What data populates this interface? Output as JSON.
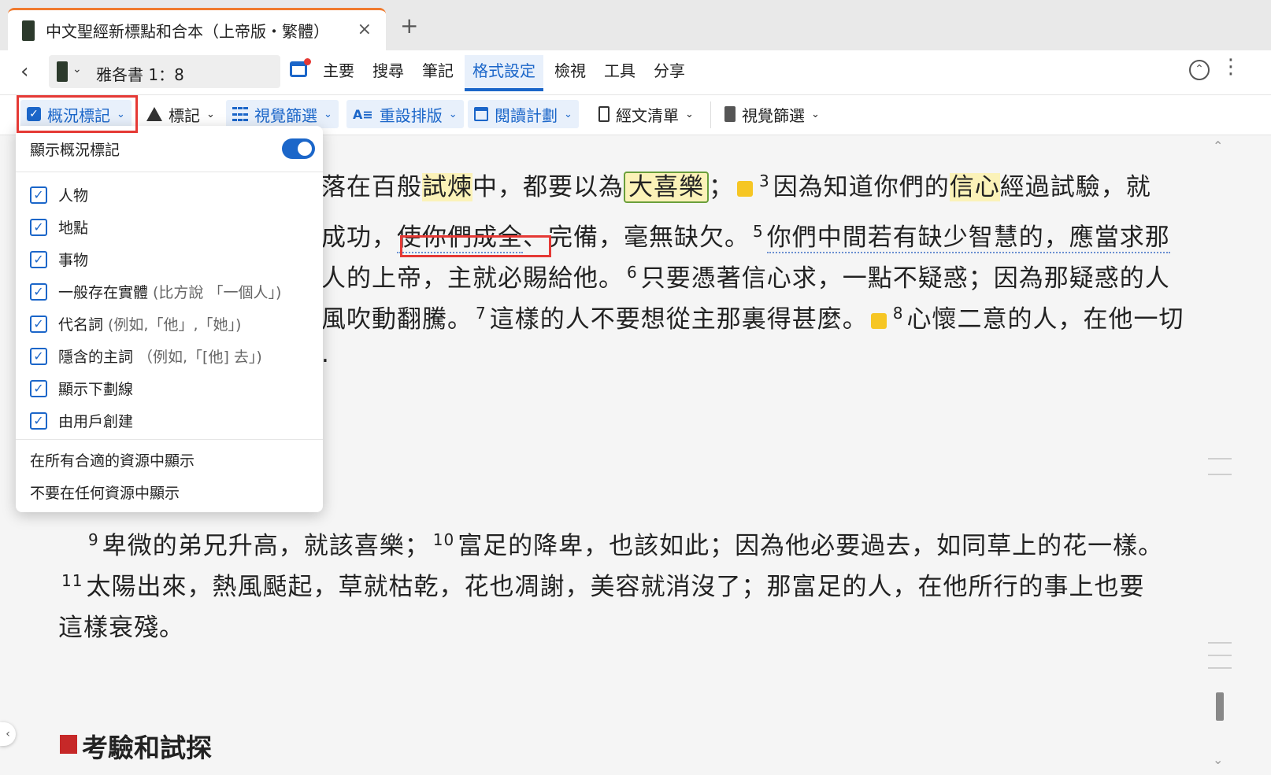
{
  "tab": {
    "title": "中文聖經新標點和合本（上帝版・繁體）",
    "close_icon": "×",
    "add_icon": "+"
  },
  "nav": {
    "back_icon": "‹",
    "reference": "雅各書 1：8",
    "menu": [
      "主要",
      "搜尋",
      "筆記",
      "格式設定",
      "檢視",
      "工具",
      "分享"
    ],
    "active_menu": "格式設定",
    "up_icon": "⌃",
    "more_icon": "⋮"
  },
  "toolbar": {
    "items": [
      {
        "label": "概況標記",
        "icon": "checkbox-icon"
      },
      {
        "label": "標記",
        "icon": "triangle-icon"
      },
      {
        "label": "視覺篩選",
        "icon": "grid-icon"
      },
      {
        "label": "重設排版",
        "icon": "text-layout-icon"
      },
      {
        "label": "閱讀計劃",
        "icon": "calendar-icon"
      },
      {
        "label": "經文清單",
        "icon": "list-icon"
      },
      {
        "label": "視覺篩選",
        "icon": "document-icon"
      }
    ],
    "caret": "⌄"
  },
  "panel": {
    "show_label": "顯示概況標記",
    "toggle_on": true,
    "options": [
      {
        "label": "人物",
        "hint": "",
        "checked": true
      },
      {
        "label": "地點",
        "hint": "",
        "checked": true
      },
      {
        "label": "事物",
        "hint": "",
        "checked": true
      },
      {
        "label": "一般存在實體",
        "hint": "(比方說 「一個人」)",
        "checked": true
      },
      {
        "label": "代名詞",
        "hint": "(例如,「他」,「她」)",
        "checked": true
      },
      {
        "label": "隱含的主詞",
        "hint": "（例如,「[他] 去」)",
        "checked": true
      },
      {
        "label": "顯示下劃線",
        "hint": "",
        "checked": true
      },
      {
        "label": "由用戶創建",
        "hint": "",
        "checked": true
      }
    ],
    "show_all": "在所有合適的資源中顯示",
    "show_none": "不要在任何資源中顯示"
  },
  "reading": {
    "line1": {
      "a": "落在百般",
      "hl1": "試煉",
      "b": "中，都要以為",
      "boxed": "大喜樂",
      "c": "；",
      "v3": "3",
      "d": "因為知道你們的",
      "hl2": "信心",
      "e": "經過試驗，就"
    },
    "line2": {
      "a": "成功，",
      "b": "使你們成全",
      "c": "、完備，毫無缺欠。",
      "v5": "5",
      "d": "你們中間若有缺少智慧的，應當求那"
    },
    "line3": {
      "a": "人的上帝，主就必賜給他。",
      "v6": "6",
      "b": "只要憑著信心求，一點不疑惑；因為那疑惑的人"
    },
    "line4": {
      "a": "風吹動翻騰。",
      "v7": "7",
      "b": "這樣的人不要想從主那裏得甚麼。",
      "v8": "8",
      "c": "心懷二意的人，在他一切"
    },
    "line5": ".",
    "line6": {
      "v9": "9",
      "a": "卑微的弟兄升高，就該喜樂；",
      "v10": "10",
      "b": "富足的降卑，也該如此；因為他必要過去，如同草上的花一樣。"
    },
    "line7": {
      "v11": "11",
      "a": "太陽出來，熱風颳起，草就枯乾，花也凋謝，美容就消沒了；那富足的人，在他所行的事上也要"
    },
    "line8": "這樣衰殘。",
    "section_title": "考驗和試探"
  },
  "colors": {
    "accent": "#1b66c9",
    "tab_accent": "#f07a2e",
    "highlight": "#fbf2b8",
    "box_border": "#6a9f3c",
    "annotation_red": "#e53935",
    "section_red": "#c62828",
    "note_yellow": "#f6c624"
  }
}
